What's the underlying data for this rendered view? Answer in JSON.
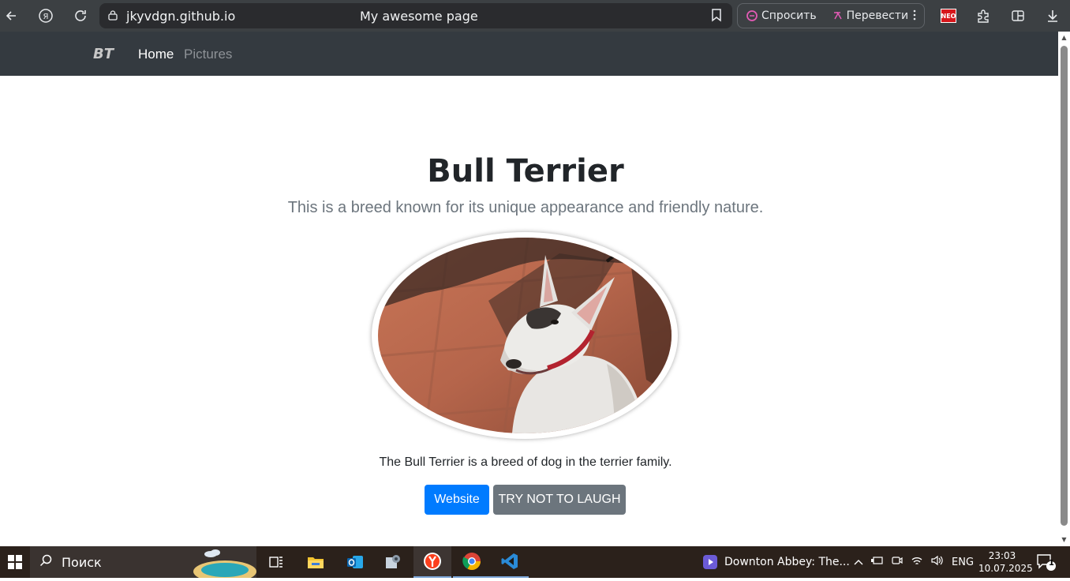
{
  "browser": {
    "domain": "jkyvdgn.github.io",
    "page_title": "My awesome page",
    "ask_label": "Спросить",
    "translate_label": "Перевести",
    "neo_label": "NEO"
  },
  "navbar": {
    "brand": "BT",
    "links": [
      {
        "label": "Home",
        "active": true
      },
      {
        "label": "Pictures",
        "active": false
      }
    ]
  },
  "hero": {
    "title": "Bull Terrier",
    "lead": "This is a breed known for its unique appearance and friendly nature.",
    "caption": "The Bull Terrier is a breed of dog in the terrier family.",
    "buttons": {
      "website": "Website",
      "laugh": "TRY NOT TO LAUGH"
    }
  },
  "colors": {
    "navbar_bg": "#343a40",
    "primary": "#007bff",
    "secondary": "#6c757d"
  },
  "taskbar": {
    "search_placeholder": "Поиск",
    "media_title": "Downton Abbey: The...",
    "language": "ENG",
    "time": "23:03",
    "date": "10.07.2025",
    "notification_count": "1"
  }
}
